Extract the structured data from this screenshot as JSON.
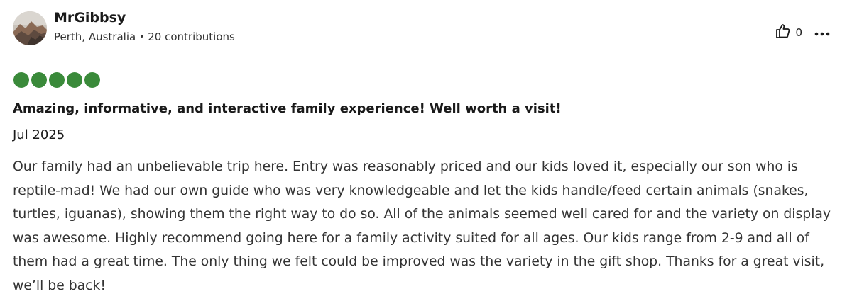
{
  "reviewer": {
    "name": "MrGibbsy",
    "location": "Perth, Australia",
    "separator": "•",
    "contributions": "20 contributions"
  },
  "actions": {
    "helpful_icon": "thumbs-up-icon",
    "helpful_count": "0",
    "more_icon": "more-options-icon"
  },
  "rating": {
    "value": 5,
    "max": 5,
    "color": "#3a8a3a"
  },
  "review": {
    "title": "Amazing, informative, and interactive family experience! Well worth a visit!",
    "date": "Jul 2025",
    "body": "Our family had an unbelievable trip here. Entry was reasonably priced and our kids loved it, especially our son who is reptile-mad! We had our own guide who was very knowledgeable and let the kids handle/feed certain animals (snakes, turtles, iguanas), showing them the right way to do so. All of the animals seemed well cared for and the variety on display was awesome. Highly recommend going here for a family activity suited for all ages. Our kids range from 2-9 and all of them had a great time. The only thing we felt could be improved was the variety in the gift shop. Thanks for a great visit, we’ll be back!"
  }
}
